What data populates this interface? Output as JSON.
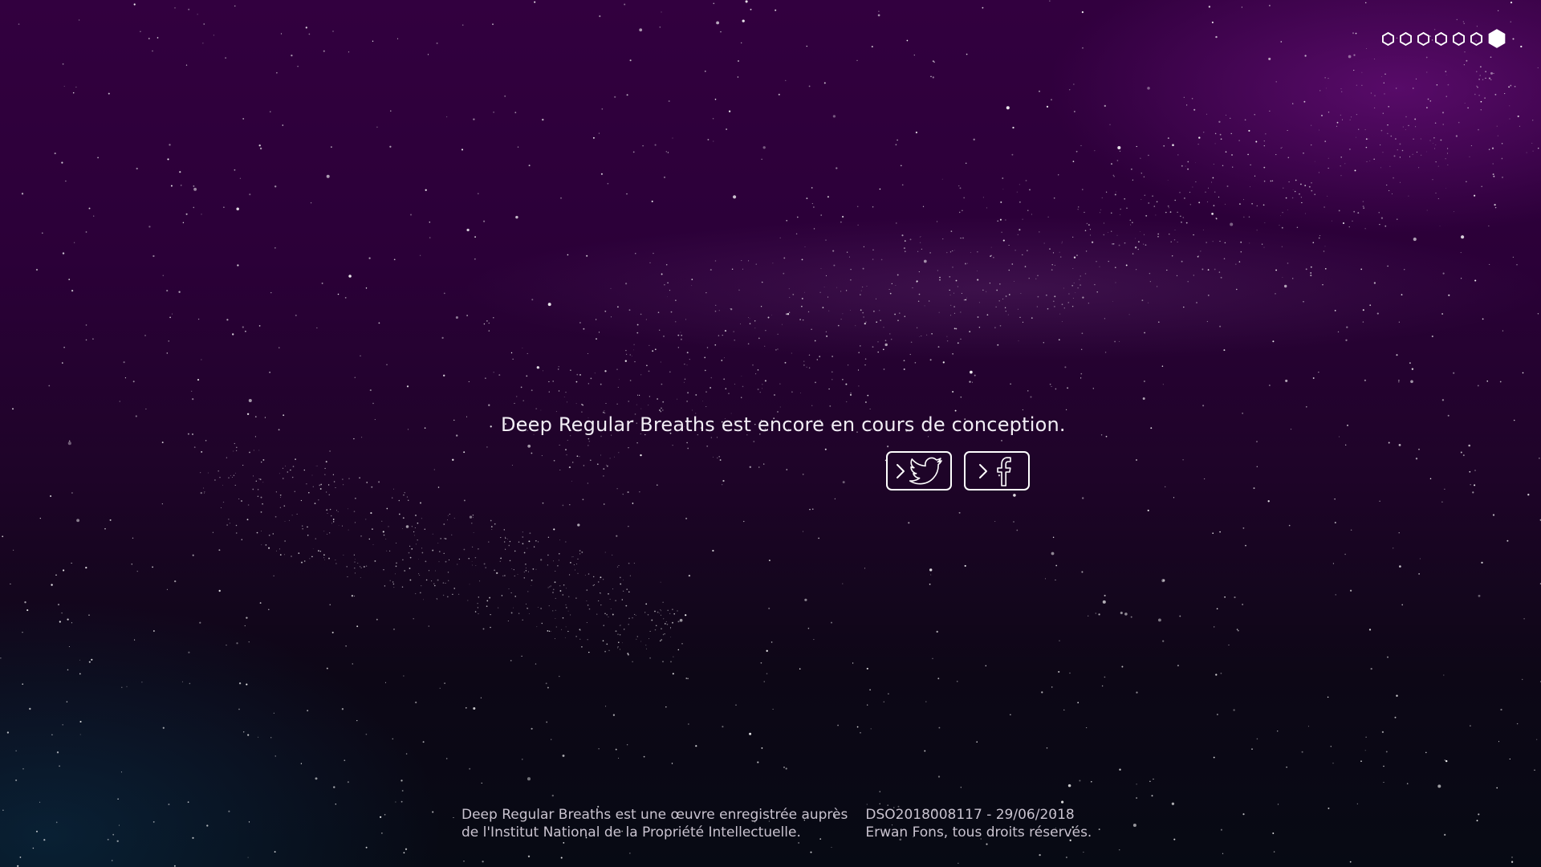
{
  "page": {
    "message": "Deep Regular Breaths est encore en cours de conception."
  },
  "nav": {
    "dots": [
      {
        "label": "page-1",
        "active": false
      },
      {
        "label": "page-2",
        "active": false
      },
      {
        "label": "page-3",
        "active": false
      },
      {
        "label": "page-4",
        "active": false
      },
      {
        "label": "page-5",
        "active": false
      },
      {
        "label": "page-6",
        "active": false
      },
      {
        "label": "page-7",
        "active": true
      }
    ]
  },
  "social": {
    "buttons": [
      {
        "icon": "twitter-icon",
        "arrow_icon": "chevron-right-icon"
      },
      {
        "icon": "facebook-icon",
        "arrow_icon": "chevron-right-icon"
      }
    ]
  },
  "footer": {
    "left_line1": "Deep Regular Breaths est une œuvre enregistrée auprès",
    "left_line2": "de l'Institut National de la Propriété Intellectuelle.",
    "right_line1": "DSO2018008117 - 29/06/2018",
    "right_line2": "Erwan Fons, tous droits réservés."
  },
  "colors": {
    "background_top": "#32003f",
    "background_bottom": "#070a14",
    "accent_glow": "#78148c",
    "text": "#ffffff",
    "footer_text": "#c9c3cf"
  }
}
